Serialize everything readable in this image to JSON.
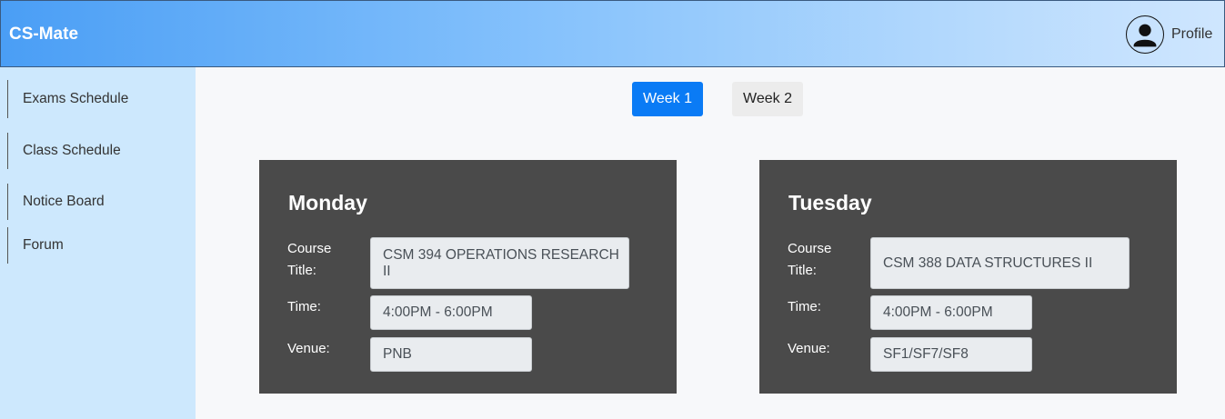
{
  "header": {
    "brand": "CS-Mate",
    "profile_label": "Profile",
    "profile_icon": "user-avatar-icon"
  },
  "sidebar": {
    "items": [
      {
        "label": "Exams Schedule"
      },
      {
        "label": "Class Schedule"
      },
      {
        "label": "Notice Board"
      },
      {
        "label": "Forum"
      }
    ]
  },
  "weeks": {
    "week1_label": "Week 1",
    "week2_label": "Week 2",
    "active": "Week 1"
  },
  "labels": {
    "course_title": "Course Title:",
    "time": "Time:",
    "venue": "Venue:"
  },
  "days": [
    {
      "day": "Monday",
      "course_title": "CSM 394 OPERATIONS RESEARCH II",
      "time": "4:00PM - 6:00PM",
      "venue": "PNB"
    },
    {
      "day": "Tuesday",
      "course_title": "CSM 388 DATA STRUCTURES II",
      "time": "4:00PM - 6:00PM",
      "venue": "SF1/SF7/SF8"
    }
  ],
  "colors": {
    "accent": "#0a7bf5",
    "card_bg": "#4a4a4a",
    "sidebar_bg": "#cde8fd"
  }
}
